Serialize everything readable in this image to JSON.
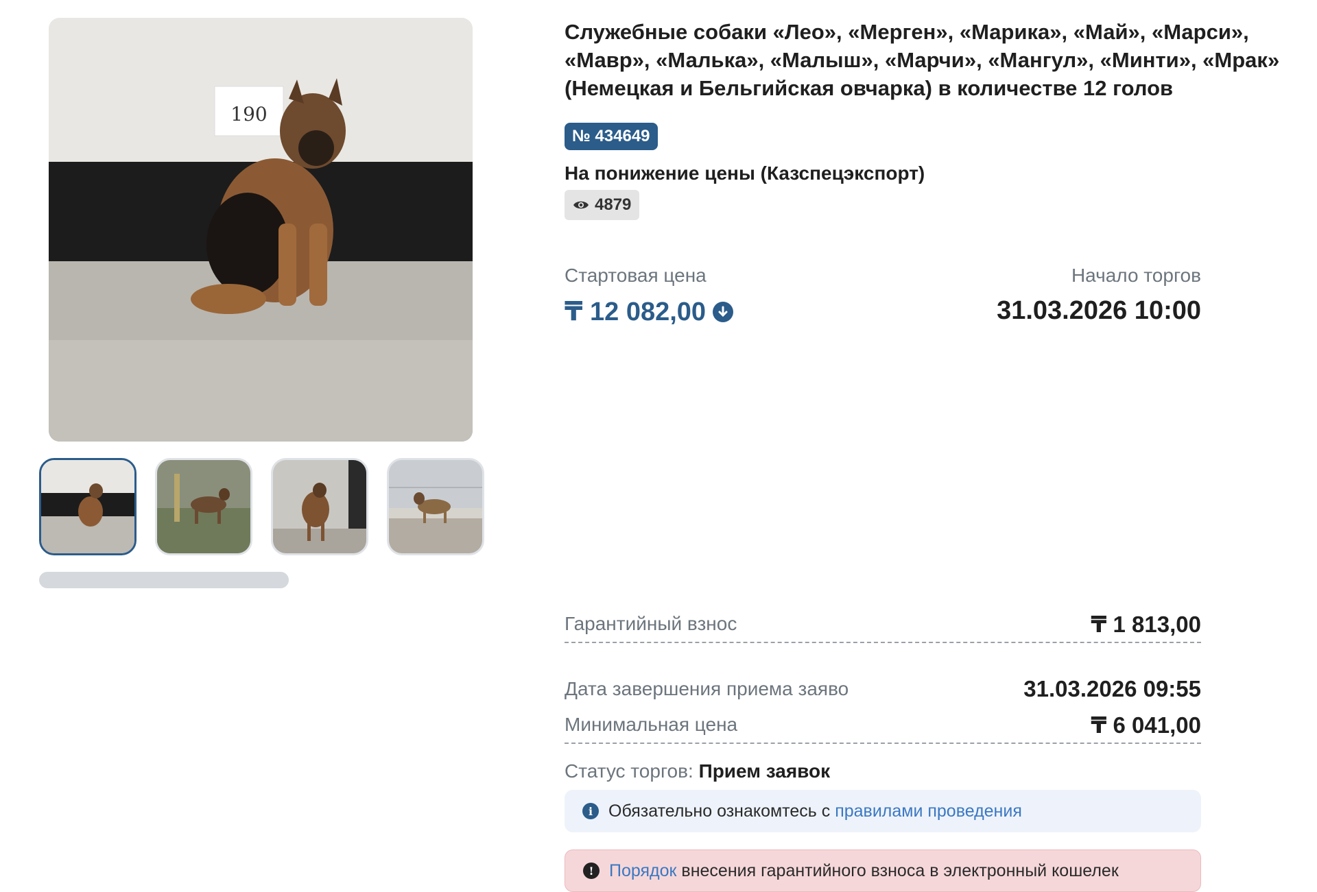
{
  "lot": {
    "title": "Служебные собаки «Лео», «Мерген», «Марика», «Май», «Марси», «Мавр», «Малька», «Малыш», «Марчи», «Мангул», «Минти», «Мрак» (Немецкая и Бельгийская овчарка) в количестве 12 голов",
    "number_badge": "№ 434649",
    "auction_type": "На понижение цены (Казспецэкспорт)",
    "views": "4879"
  },
  "gallery": {
    "main_photo_label": "190",
    "thumbnails": [
      "thumb-1",
      "thumb-2",
      "thumb-3",
      "thumb-4"
    ]
  },
  "pricing": {
    "start_price_label": "Стартовая цена",
    "start_price": "₸ 12 082,00",
    "start_time_label": "Начало торгов",
    "start_time": "31.03.2026 10:00",
    "guarantee_label": "Гарантийный взнос",
    "guarantee_value": "₸ 1 813,00",
    "end_apps_label": "Дата завершения приема заяво",
    "end_apps_value": "31.03.2026 09:55",
    "min_price_label": "Минимальная цена",
    "min_price_value": "₸ 6 041,00"
  },
  "status": {
    "label": "Статус торгов:",
    "value": "Прием заявок"
  },
  "notices": {
    "info_text": "Обязательно ознакомтесь с",
    "info_link": "правилами проведения",
    "warn_link": "Порядок",
    "warn_text": "внесения гарантийного взноса в электронный кошелек"
  },
  "colors": {
    "accent": "#2b5c8a",
    "info_bg": "#eef3fb",
    "warn_bg": "#f6d7d9"
  },
  "icons": [
    "eye-icon",
    "arrow-down-circle-icon",
    "info-icon",
    "exclamation-icon"
  ]
}
